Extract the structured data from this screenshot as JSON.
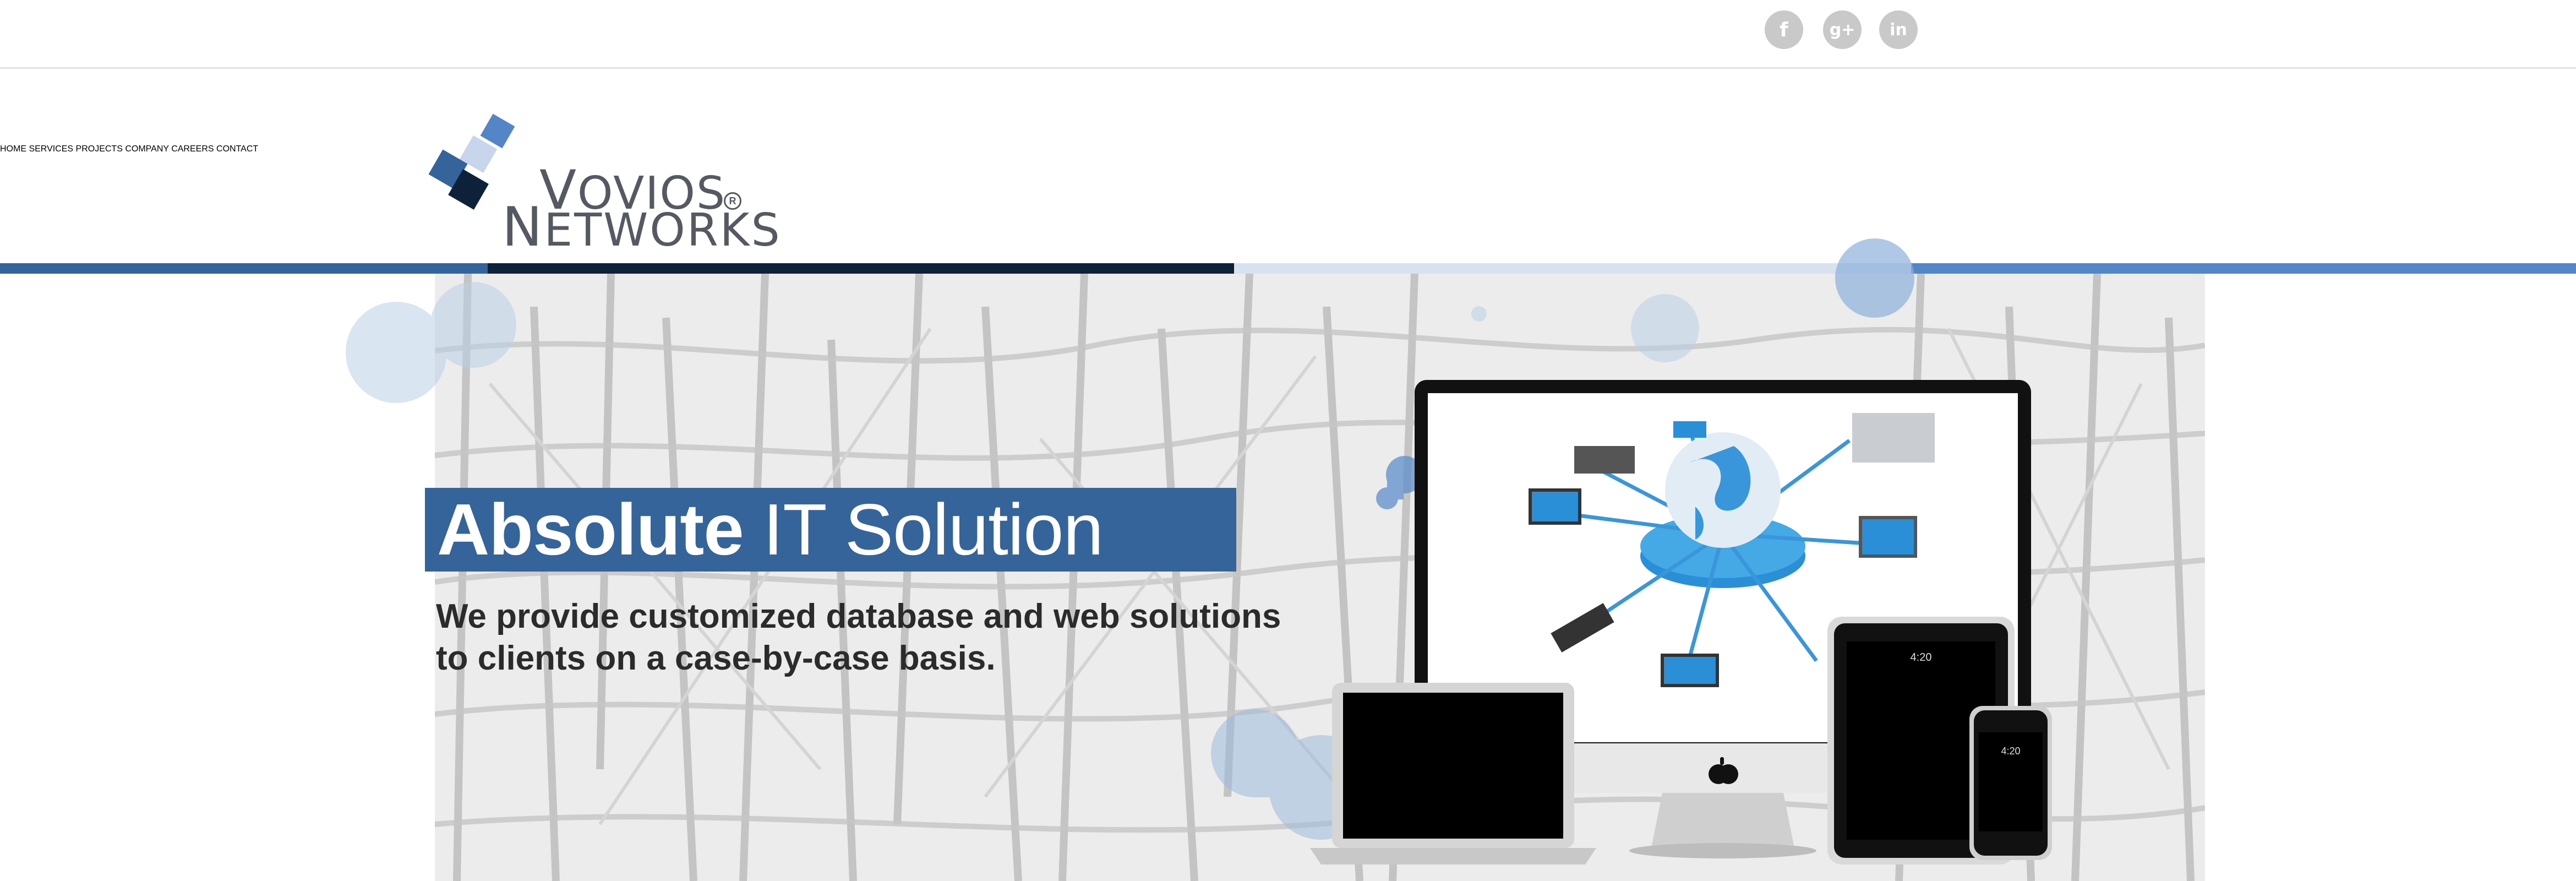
{
  "social": {
    "facebook": "f",
    "google_plus": "g+",
    "linkedin": "in"
  },
  "logo": {
    "line1_initial": "V",
    "line1_rest": "OVIOS",
    "line2_initial": "N",
    "line2_rest": "ETWORKS",
    "registered": "R"
  },
  "nav": [
    {
      "label": "HOME"
    },
    {
      "label": "SERVICES"
    },
    {
      "label": "PROJECTS"
    },
    {
      "label": "COMPANY"
    },
    {
      "label": "CAREERS"
    },
    {
      "label": "CONTACT"
    }
  ],
  "hero": {
    "headline_bold": "Absolute",
    "headline_rest": " IT Solution",
    "subtext_line1": "We provide customized database and web solutions",
    "subtext_line2": "to clients on a case-by-case basis."
  },
  "device_screens": {
    "tablet_time": "4:20",
    "phone_time": "4:20"
  },
  "colors": {
    "brand_blue": "#35649b",
    "brand_navy": "#0d2238",
    "brand_light": "#d7e1f0",
    "brand_bright": "#5486c7",
    "nav_text": "#3a3a3a",
    "social_icon_bg": "#c9c9c9"
  },
  "icons": [
    "facebook-icon",
    "google-plus-icon",
    "linkedin-icon",
    "logo-mark-icon",
    "apple-logo-icon",
    "globe-icon"
  ]
}
